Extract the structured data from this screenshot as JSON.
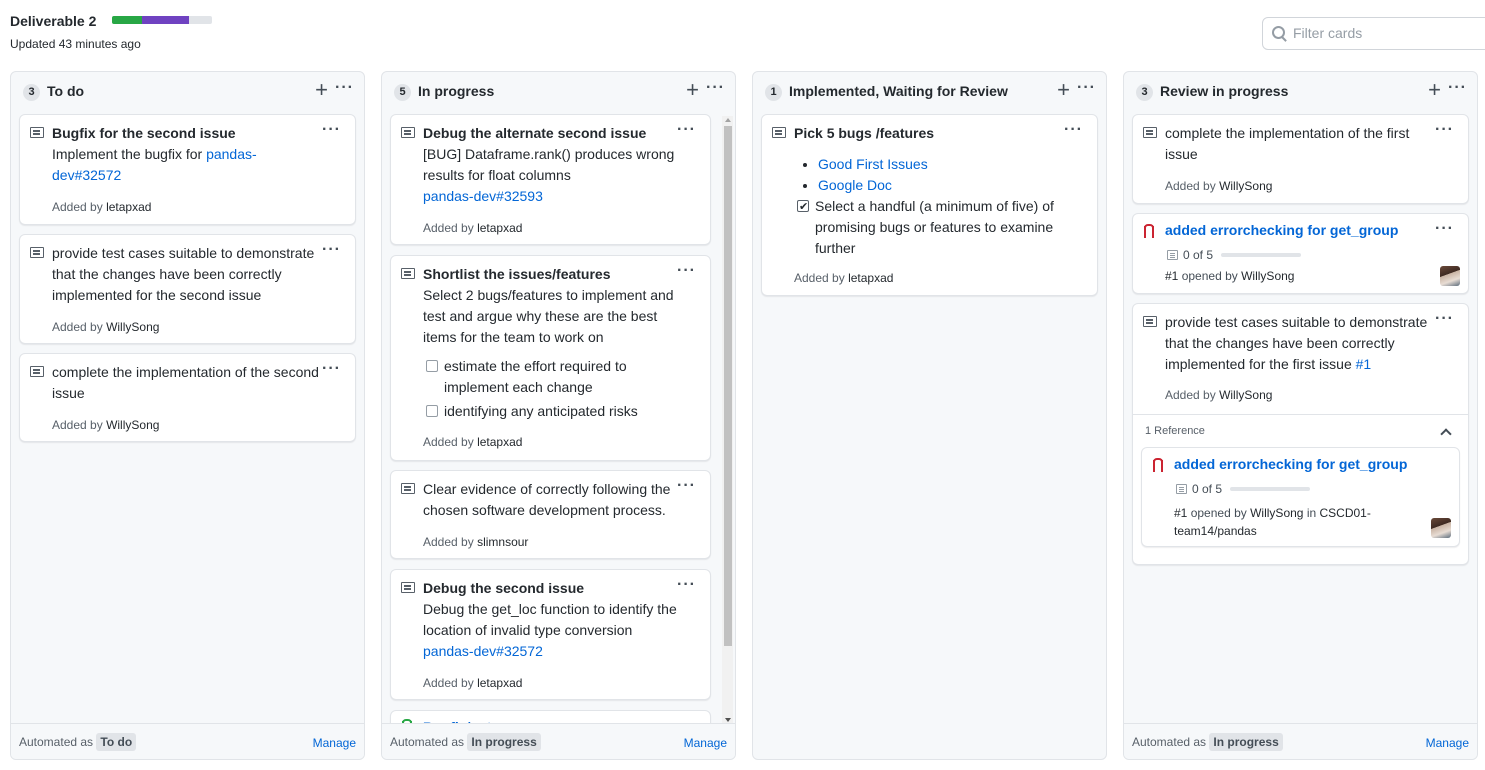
{
  "project": {
    "title": "Deliverable 2",
    "updated": "Updated 43 minutes ago",
    "progress": {
      "done_percent": 30,
      "in_progress_percent": 47,
      "colors": {
        "done": "#28a745",
        "in_progress": "#6f42c1"
      }
    }
  },
  "filter": {
    "placeholder": "Filter cards"
  },
  "common": {
    "added_by": "Added by",
    "automated_as": "Automated as",
    "manage": "Manage",
    "opened_by": "opened by",
    "in": "in"
  },
  "columns": [
    {
      "count": "3",
      "name": "To do",
      "automation": "To do",
      "cards": [
        {
          "title": "Bugfix for the second issue",
          "text": "Implement the bugfix for ",
          "link": "pandas-dev#32572",
          "author": "letapxad"
        },
        {
          "text": "provide test cases suitable to demonstrate that the changes have been correctly implemented for the second issue",
          "author": "WillySong"
        },
        {
          "text": "complete the implementation of the second issue",
          "author": "WillySong"
        }
      ]
    },
    {
      "count": "5",
      "name": "In progress",
      "automation": "In progress",
      "cards": [
        {
          "title": "Debug the alternate second issue",
          "text": "[BUG] Dataframe.rank() produces wrong results for float columns",
          "link": "pandas-dev#32593",
          "author": "letapxad"
        },
        {
          "title": "Shortlist the issues/features",
          "text": "Select 2 bugs/features to implement and test and argue why these are the best items for the team to work on",
          "tasks": [
            "estimate the effort required to implement each change",
            "identifying any anticipated risks"
          ],
          "author": "letapxad"
        },
        {
          "text": "Clear evidence of correctly following the chosen software development process.",
          "author": "slimnsour"
        },
        {
          "title": "Debug the second issue",
          "text": "Debug the get_loc function to identify the location of invalid type conversion",
          "link": "pandas-dev#32572",
          "author": "letapxad"
        },
        {
          "title": "Bugfix/get_group"
        }
      ]
    },
    {
      "count": "1",
      "name": "Implemented, Waiting for Review",
      "cards": [
        {
          "title": "Pick 5 bugs /features",
          "links": [
            "Good First Issues",
            "Google Doc"
          ],
          "task": "Select a handful (a minimum of five) of promising bugs or features to examine further",
          "author": "letapxad"
        }
      ]
    },
    {
      "count": "3",
      "name": "Review in progress",
      "automation": "In progress",
      "cards": [
        {
          "text": "complete the implementation of the first issue",
          "author": "WillySong"
        },
        {
          "pr_title": "added errorchecking for get_group",
          "tasks": "0 of 5",
          "number": "#1",
          "author": "WillySong"
        },
        {
          "text": "provide test cases suitable to demonstrate that the changes have been correctly implemented for the first issue ",
          "link": "#1",
          "author": "WillySong",
          "reference_label": "1 Reference",
          "reference": {
            "pr_title": "added errorchecking for get_group",
            "tasks": "0 of 5",
            "number": "#1",
            "author": "WillySong",
            "repo": "CSCD01-team14/pandas"
          }
        }
      ]
    }
  ]
}
